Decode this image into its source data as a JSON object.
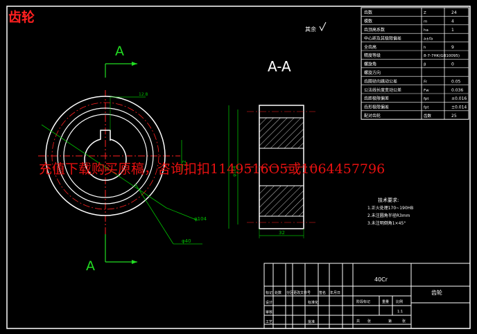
{
  "header_title": "齿轮",
  "watermark": "充值下载购买原稿，咨询扣扣1149516O5或1064457796",
  "surface_finish": "其余",
  "section_letter_top": "A",
  "section_letter_bottom": "A",
  "section_view_label": "A-A",
  "dimensions": {
    "keyway_depth": "12.8",
    "keyway_width": "12",
    "outer_dia": "φ104",
    "hub_dia": "φ40",
    "face_width": "32",
    "height_left": "φ104"
  },
  "param_table": [
    {
      "name": "齿数",
      "symbol": "Z",
      "value": "24"
    },
    {
      "name": "模数",
      "symbol": "m",
      "value": "4"
    },
    {
      "name": "齿顶高系数",
      "symbol": "ha",
      "value": "1"
    },
    {
      "name": "中心距及其极限偏差",
      "symbol": "a±fa",
      "value": ""
    },
    {
      "name": "全齿高",
      "symbol": "h",
      "value": "9"
    },
    {
      "name": "精度等级",
      "symbol": "8-7-7HK(GB10095)",
      "value": ""
    },
    {
      "name": "螺旋角",
      "symbol": "β",
      "value": "0"
    },
    {
      "name": "螺旋方向",
      "symbol": "",
      "value": ""
    },
    {
      "name": "齿圈径向跳动公差",
      "symbol": "Fr",
      "value": "0.05"
    },
    {
      "name": "公法线长度变动公差",
      "symbol": "Fw",
      "value": "0.036"
    },
    {
      "name": "齿距极限偏差",
      "symbol": "fpt",
      "value": "±0.016"
    },
    {
      "name": "齿形极限偏差",
      "symbol": "fpt",
      "value": "±0.014"
    },
    {
      "name": "配对齿轮",
      "symbol": "齿数",
      "value": "25"
    }
  ],
  "tech_req": {
    "title": "技术要求:",
    "items": [
      "1.正火处理170~190HB",
      "2.未注圆角半径R3mm",
      "3.未注明倒角1×45°"
    ]
  },
  "title_block": {
    "material": "40Cr",
    "part_name": "齿轮",
    "stage_label": "阶段标记",
    "weight_label": "重量",
    "scale_label": "比例",
    "scale_value": "1:1",
    "sheet_total": "共",
    "sheet_label": "张",
    "sheet_no": "第",
    "sheet_unit": "张",
    "row_labels": [
      "标记",
      "设计",
      "审核",
      "工艺"
    ],
    "col_labels": [
      "处数",
      "分区",
      "更改文件号",
      "签名",
      "年月日"
    ],
    "std_label": "标准化",
    "approve_label": "批准"
  },
  "colors": {
    "outline": "#ffffff",
    "centerline": "#ff2020",
    "dimension": "#00c000",
    "hatch": "#ffffff",
    "accent_green": "#22dd22",
    "watermark": "#e81010"
  }
}
